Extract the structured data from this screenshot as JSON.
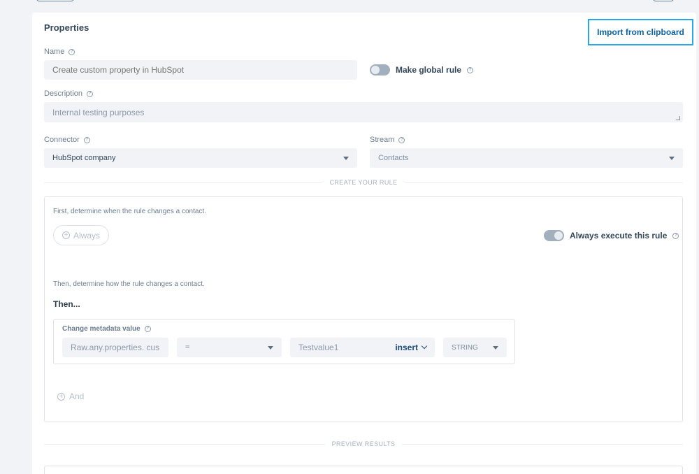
{
  "properties": {
    "title": "Properties",
    "import_button": "Import from clipboard",
    "name": {
      "label": "Name",
      "placeholder": "Create custom property in HubSpot"
    },
    "global_rule": {
      "label": "Make global rule",
      "enabled": false
    },
    "description": {
      "label": "Description",
      "value": "Internal testing purposes"
    },
    "connector": {
      "label": "Connector",
      "value": "HubSpot company"
    },
    "stream": {
      "label": "Stream",
      "value": "Contacts"
    }
  },
  "rule": {
    "section_title": "CREATE YOUR RULE",
    "when_hint": "First, determine when the rule changes a contact.",
    "always_label": "Always",
    "always_execute": {
      "label": "Always execute this rule",
      "enabled": true
    },
    "how_hint": "Then, determine how the rule changes a contact.",
    "then_label": "Then...",
    "action": {
      "title": "Change metadata value",
      "field_value": "Raw.any.properties. cus",
      "operator": "=",
      "value": "Testvalue1",
      "insert_label": "insert",
      "type": "STRING"
    },
    "and_label": "And"
  },
  "preview": {
    "section_title": "PREVIEW RESULTS"
  },
  "colors": {
    "accent": "#27a7e7",
    "link": "#0b62a4",
    "text": "#33475b"
  }
}
